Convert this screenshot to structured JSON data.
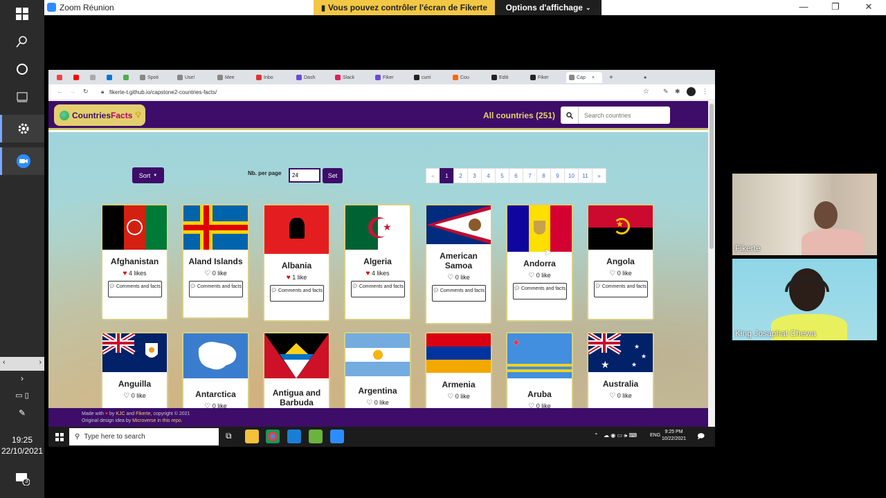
{
  "zoom": {
    "title": "Zoom Réunion",
    "share_banner": "Vous pouvez contrôler l'écran de Fikerte",
    "view_options": "Options d'affichage"
  },
  "left_bar": {
    "time": "19:25",
    "date": "22/10/2021",
    "notification_count": "3"
  },
  "browser": {
    "tabs": [
      "Spoti",
      "Use!",
      "Mee",
      "Inbo",
      "Dash",
      "Slack",
      "Fiker",
      "curri",
      "Cou",
      "Editi",
      "Fiker",
      "Cap"
    ],
    "url": "fikerte-t.github.io/capstone2-countries-facts/"
  },
  "site": {
    "logo_part1": "Countries",
    "logo_part2": "Facts",
    "all_countries": "All countries (251)",
    "search_placeholder": "Search countries",
    "sort_label": "Sort",
    "per_page_label": "Nb. per page",
    "per_page_value": "24",
    "set_label": "Set",
    "pagination": [
      "«",
      "1",
      "2",
      "3",
      "4",
      "5",
      "6",
      "7",
      "8",
      "9",
      "10",
      "11",
      "»"
    ],
    "comments_label": "Comments and facts",
    "countries": [
      {
        "name": "Afghanistan",
        "likes": "4 likes",
        "liked": true
      },
      {
        "name": "Aland Islands",
        "likes": "0 like",
        "liked": false
      },
      {
        "name": "Albania",
        "likes": "1 like",
        "liked": true
      },
      {
        "name": "Algeria",
        "likes": "4 likes",
        "liked": true
      },
      {
        "name": "American Samoa",
        "likes": "0 like",
        "liked": false
      },
      {
        "name": "Andorra",
        "likes": "0 like",
        "liked": false
      },
      {
        "name": "Angola",
        "likes": "0 like",
        "liked": false
      },
      {
        "name": "Anguilla",
        "likes": "0 like",
        "liked": false
      },
      {
        "name": "Antarctica",
        "likes": "0 like",
        "liked": false
      },
      {
        "name": "Antigua and Barbuda",
        "likes": "",
        "liked": false
      },
      {
        "name": "Argentina",
        "likes": "0 like",
        "liked": false
      },
      {
        "name": "Armenia",
        "likes": "0 like",
        "liked": false
      },
      {
        "name": "Aruba",
        "likes": "0 like",
        "liked": false
      },
      {
        "name": "Australia",
        "likes": "0 like",
        "liked": false
      }
    ],
    "footer_made_with": "Made with",
    "footer_by": "by",
    "footer_author1": "KJC",
    "footer_and": "and",
    "footer_author2": "Fikerte",
    "footer_copyright": ", copyright © 2021",
    "footer_original": "Original design idea by",
    "footer_microverse": "Microverse",
    "footer_in": "in",
    "footer_repo": "this repo."
  },
  "inner_taskbar": {
    "search_placeholder": "Type here to search",
    "lang": "ENG",
    "time": "9:25 PM",
    "date": "10/22/2021"
  },
  "participants": [
    {
      "name": "Fikerte"
    },
    {
      "name": "King Josaphat Chewa"
    }
  ],
  "colors": {
    "site_purple": "#3d0d69",
    "site_gold": "#e6d36a",
    "zoom_banner": "#f2c744"
  }
}
